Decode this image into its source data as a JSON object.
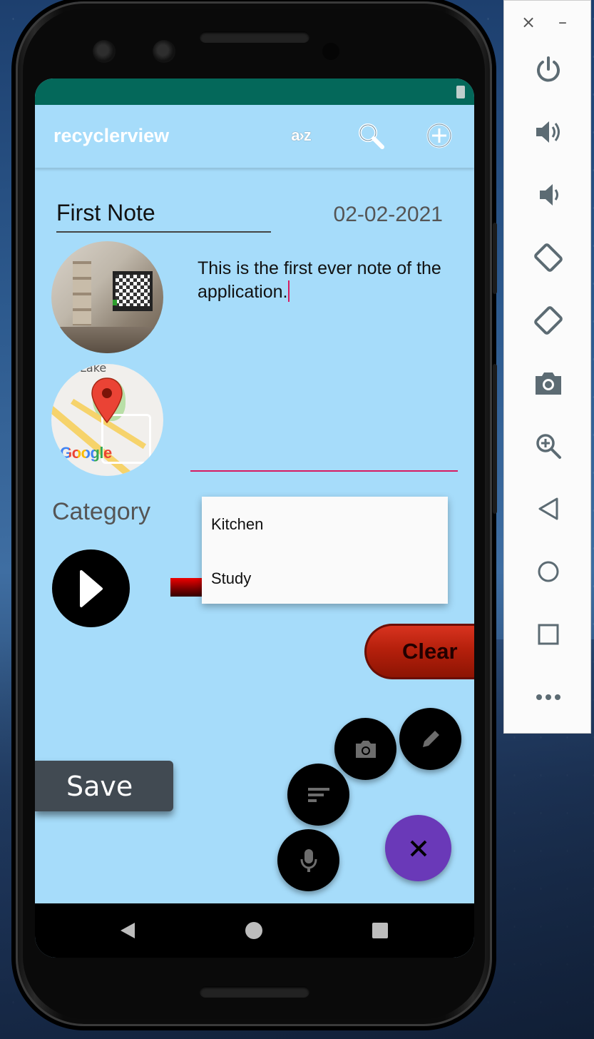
{
  "app": {
    "title": "recyclerview",
    "sort_label": "a›z"
  },
  "note": {
    "title": "First Note",
    "date": "02-02-2021",
    "body": "This is the first ever note of the application.",
    "map_label": "Lake",
    "map_brand": "Google"
  },
  "category": {
    "label": "Category",
    "options": [
      "Kitchen",
      "Study"
    ]
  },
  "buttons": {
    "clear": "Clear",
    "save": "Save"
  },
  "fab": {
    "close": "×"
  },
  "colors": {
    "screen_bg": "#a6dcfa",
    "status_bar": "#04685a",
    "accent": "#d81b60",
    "fab_main": "#6a39b8",
    "clear_red": "#b5200c",
    "save_bg": "#414a52"
  },
  "toolbar": {
    "close": "×",
    "minimize": "–"
  }
}
